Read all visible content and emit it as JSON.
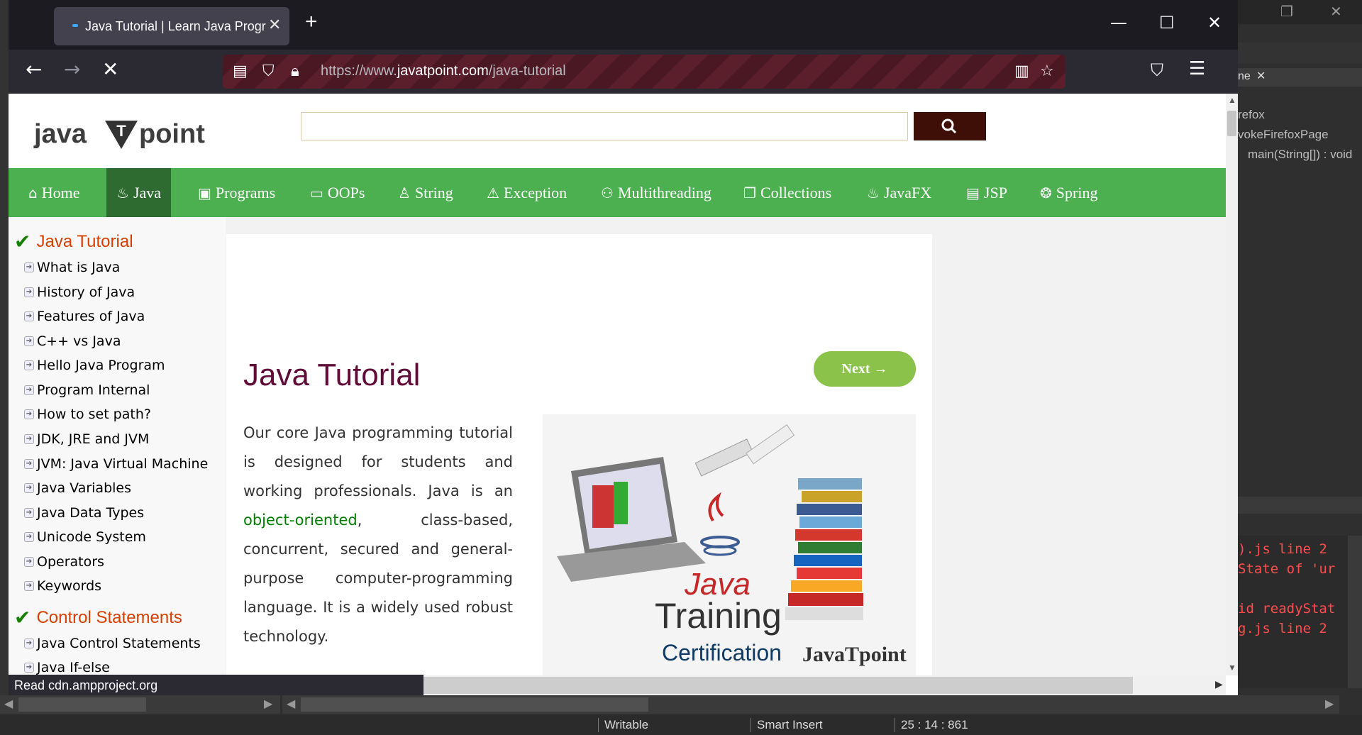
{
  "browser": {
    "tab_title": "Java Tutorial | Learn Java Progra",
    "new_tab": "+",
    "url_prefix": "https://www.",
    "url_domain": "javatpoint.com",
    "url_path": "/java-tutorial",
    "status_text": "Read cdn.ampproject.org",
    "icons": [
      "back-icon",
      "forward-icon",
      "stop-icon",
      "shield-icon",
      "lock-icon",
      "reader-icon",
      "bookmark-star-icon",
      "pocket-icon",
      "menu-icon"
    ]
  },
  "site": {
    "logo_left": "java",
    "logo_mark": "T",
    "logo_right": "point",
    "menu": [
      {
        "label": "Home",
        "icon": "home-icon"
      },
      {
        "label": "Java",
        "icon": "java-cup-icon",
        "active": true
      },
      {
        "label": "Programs",
        "icon": "monitor-icon"
      },
      {
        "label": "OOPs",
        "icon": "window-icon"
      },
      {
        "label": "String",
        "icon": "string-icon"
      },
      {
        "label": "Exception",
        "icon": "warning-icon"
      },
      {
        "label": "Multithreading",
        "icon": "threads-icon"
      },
      {
        "label": "Collections",
        "icon": "collections-icon"
      },
      {
        "label": "JavaFX",
        "icon": "javafx-icon"
      },
      {
        "label": "JSP",
        "icon": "jsp-icon"
      },
      {
        "label": "Spring",
        "icon": "spring-icon"
      }
    ]
  },
  "sidebar": {
    "heading1": "Java Tutorial",
    "items1": [
      "What is Java",
      "History of Java",
      "Features of Java",
      "C++ vs Java",
      "Hello Java Program",
      "Program Internal",
      "How to set path?",
      "JDK, JRE and JVM",
      "JVM: Java Virtual Machine",
      "Java Variables",
      "Java Data Types",
      "Unicode System",
      "Operators",
      "Keywords"
    ],
    "heading2": "Control Statements",
    "items2": [
      "Java Control Statements",
      "Java If-else"
    ]
  },
  "article": {
    "title": "Java Tutorial",
    "next_label": "Next →",
    "para_before": "Our core Java programming tutorial is designed for students and working professionals. Java is an ",
    "para_link": "object-oriented",
    "para_after": ", class-based, concurrent, secured and general-purpose computer-programming language. It is a widely used robust technology.",
    "hero": {
      "java": "Java",
      "training": "Training",
      "certification": "Certification",
      "brand": "JavaTpoint"
    }
  },
  "eclipse": {
    "tab_fragment": "ne",
    "outline": [
      "refox",
      "vokeFirefoxPage",
      "main(String[]) : void"
    ],
    "console": [
      ").js line 2",
      "State of 'ur",
      "",
      "id readyStat",
      "g.js line 2"
    ],
    "status": {
      "writable": "Writable",
      "insert_mode": "Smart Insert",
      "position": "25 : 14 : 861"
    }
  },
  "colors": {
    "menu_green": "#4caf50",
    "menu_active": "#2e6b30",
    "title_maroon": "#610b38",
    "sidebar_heading": "#d73f00",
    "next_button": "#8bc34a"
  }
}
